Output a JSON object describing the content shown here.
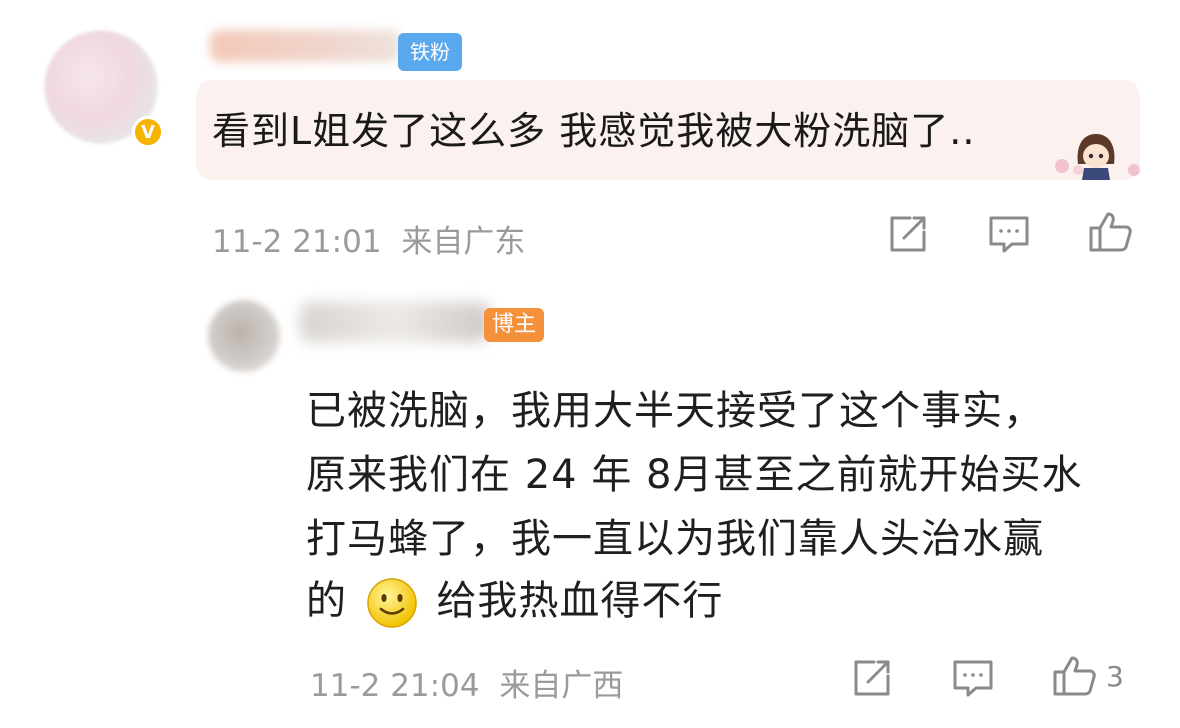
{
  "comment": {
    "badge": "铁粉",
    "text": "看到L姐发了这么多 我感觉我被大粉洗脑了..",
    "time": "11-2 21:01",
    "location": "来自广东",
    "sticker": "anime-girl-sticker"
  },
  "reply": {
    "badge": "博主",
    "lines": [
      "已被洗脑，我用大半天接受了这个事实，",
      "原来我们在 24 年 8月甚至之前就开始买水",
      "打马蜂了，我一直以为我们靠人头治水赢",
      "的",
      "给我热血得不行"
    ],
    "emoji": "smile-emoji",
    "time": "11-2 21:04",
    "location": "来自广西",
    "like_count": "3"
  },
  "icons": [
    "share-icon",
    "comment-icon",
    "like-icon",
    "verified-icon"
  ],
  "colors": {
    "bubble": "#fbf1ef",
    "verified": "#f6b400",
    "fan_badge": "#5aa8ee",
    "owner_badge": "#f5913b",
    "meta_text": "#9a9a9a"
  }
}
